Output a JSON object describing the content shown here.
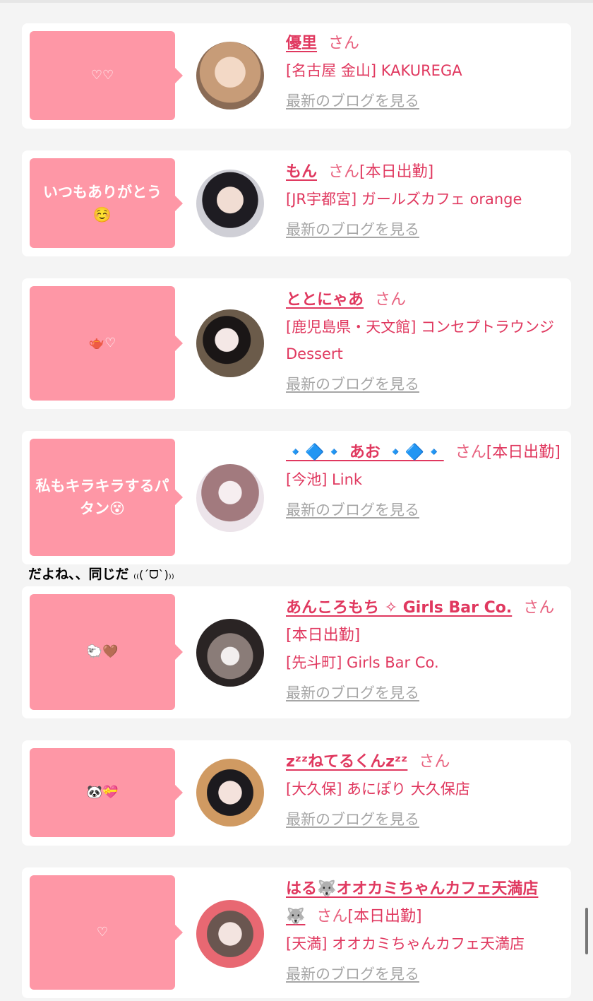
{
  "common": {
    "blog_link": "最新のブログを見る"
  },
  "outside_comment": {
    "text": "だよね、、同じだ",
    "kaomoji": "₍₍(ˊᗜˋ)₎₎"
  },
  "cards": [
    {
      "bubble": "♡♡",
      "name": "優里",
      "san": "さん",
      "tag": "",
      "shop": "[名古屋 金山] KAKUREGA"
    },
    {
      "bubble": "いつもありがとう☺️",
      "name": "もん",
      "san": "さん",
      "tag": "[本日出勤]",
      "shop": "[JR宇都宮] ガールズカフェ orange"
    },
    {
      "bubble": "🫖♡",
      "name": "ととにゃあ",
      "san": "さん",
      "tag": "",
      "shop": "[鹿児島県・天文館] コンセプトラウンジ Dessert"
    },
    {
      "bubble": "私もキラキラするパタン😵",
      "name": "🔹🔷🔹 あお 🔹🔷🔹",
      "san": "さん",
      "tag": "[本日出勤]",
      "shop": "[今池] Link"
    },
    {
      "bubble": "🐑🤎",
      "name": "あんころもち ✧ Girls Bar Co.",
      "san": "さん",
      "tag": "[本日出勤]",
      "shop": "[先斗町] Girls Bar Co."
    },
    {
      "bubble": "🐼💝",
      "name": "zᶻᶻねてるくんzᶻᶻ",
      "san": "さん",
      "tag": "",
      "shop": "[大久保] あにぽり 大久保店"
    },
    {
      "bubble": "♡",
      "name": "はる🐺オオカミちゃんカフェ天満店🐺",
      "san": "さん",
      "tag": "[本日出勤]",
      "shop": "[天満] オオカミちゃんカフェ天満店"
    }
  ],
  "colors": {
    "bubble": "#fe97a6",
    "accent": "#e0385f",
    "link_gray": "#a6a6a6",
    "background": "#f4f4f4"
  }
}
